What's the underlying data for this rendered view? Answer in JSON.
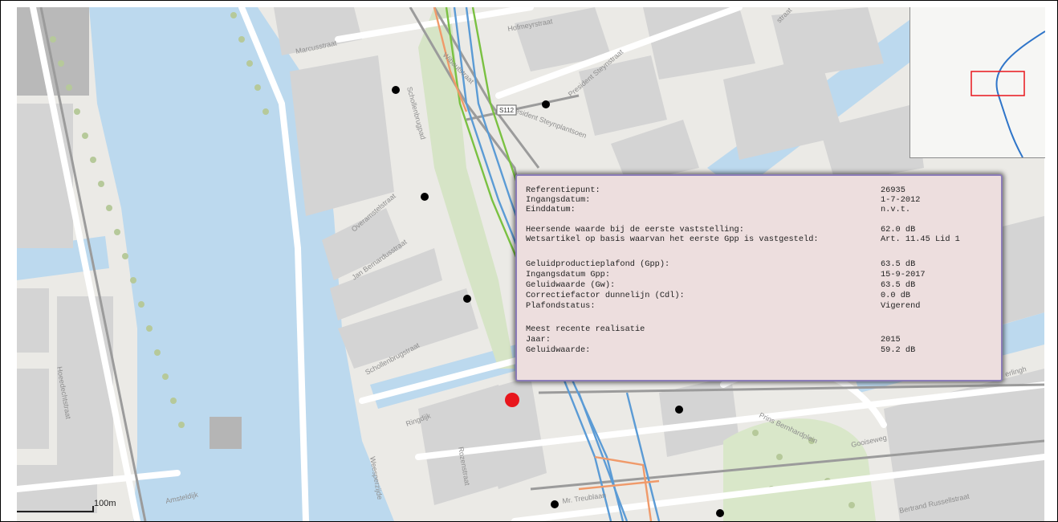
{
  "map": {
    "street_labels": {
      "marcusstraat": "Marcusstraat",
      "hofmeyrstraat": "Hofmeyrstraat",
      "president_steynplantsoen": "President Steynplantsoen",
      "president_steynstraat": "President Steynstraat",
      "wibautstraat": "Wibautstraat",
      "schollenbrugpad": "Schollenbrugpad",
      "overamstelstraat": "Overamstelstraat",
      "jan_bernardusstraat": "Jan Bernardusstraat",
      "schollenbrugstraat": "Schollenbrugstraat",
      "ringdijk": "Ringdijk",
      "hoeedechtstraat": "Hoeedechtstraat",
      "amsteldijk": "Amsteldijk",
      "weesperzijde": "Weesperzijde",
      "rozenstraat": "Rozenstraat",
      "mr_treublaan": "Mr. Treublaan",
      "prins_bernhardplein": "Prins Bernhardplein",
      "gooiseweg": "Gooiseweg",
      "bertrand_russellstraat": "Bertrand Russellstraat",
      "overlap_right": "erlingh",
      "corner_top": "straat"
    },
    "road_shield": "S112",
    "colors": {
      "water": "#bcd9ee",
      "building": "#d5d5d5",
      "green": "#d7e5c8",
      "rail_blue": "#5b9bd5",
      "rail_green": "#7ac142",
      "rail_orange": "#f09a6a",
      "point_black": "#000000",
      "point_red": "#e8161c"
    },
    "scale_label": "100m"
  },
  "popup": {
    "rows": [
      {
        "key": "Referentiepunt:",
        "value": "26935"
      },
      {
        "key": "Ingangsdatum:",
        "value": "1-7-2012"
      },
      {
        "key": "Einddatum:",
        "value": "n.v.t."
      },
      {
        "key": "Heersende waarde bij de eerste vaststelling:",
        "value": "62.0 dB"
      },
      {
        "key": "Wetsartikel op basis waarvan het eerste Gpp is vastgesteld:",
        "value": "Art. 11.45 Lid 1"
      },
      {
        "key": "Geluidproductieplafond (Gpp):",
        "value": "63.5 dB"
      },
      {
        "key": "Ingangsdatum Gpp:",
        "value": "15-9-2017"
      },
      {
        "key": "Geluidwaarde (Gw):",
        "value": "63.5 dB"
      },
      {
        "key": "Correctiefactor dunnelijn (Cdl):",
        "value": "0.0 dB"
      },
      {
        "key": "Plafondstatus:",
        "value": "Vigerend"
      },
      {
        "key": "Meest recente realisatie",
        "value": ""
      },
      {
        "key": "Jaar:",
        "value": "2015"
      },
      {
        "key": "Geluidwaarde:",
        "value": "59.2 dB"
      }
    ]
  }
}
